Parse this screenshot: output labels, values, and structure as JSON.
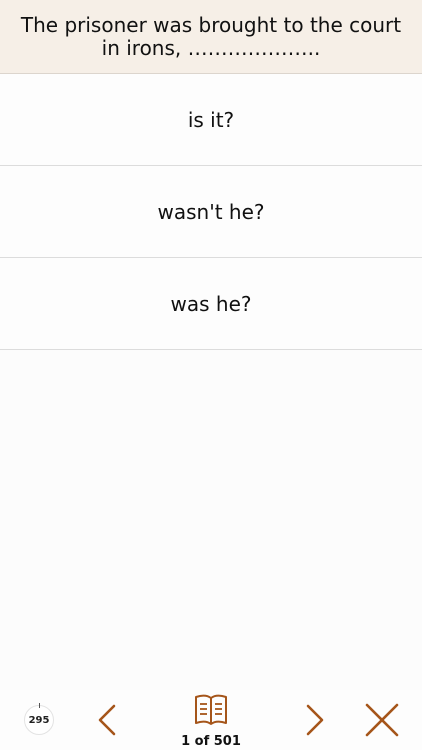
{
  "question": {
    "text": "The prisoner was brought to the court in irons, ……………….."
  },
  "answers": [
    {
      "label": "is it?"
    },
    {
      "label": "wasn't he?"
    },
    {
      "label": "was he?"
    }
  ],
  "bottom_bar": {
    "counter": "295",
    "page_indicator": "1 of 501",
    "icons": {
      "prev": "chevron-left-icon",
      "book": "open-book-icon",
      "next": "chevron-right-icon",
      "close": "close-icon"
    }
  },
  "colors": {
    "accent": "#a5551a",
    "question_bg": "#f6efe7"
  }
}
